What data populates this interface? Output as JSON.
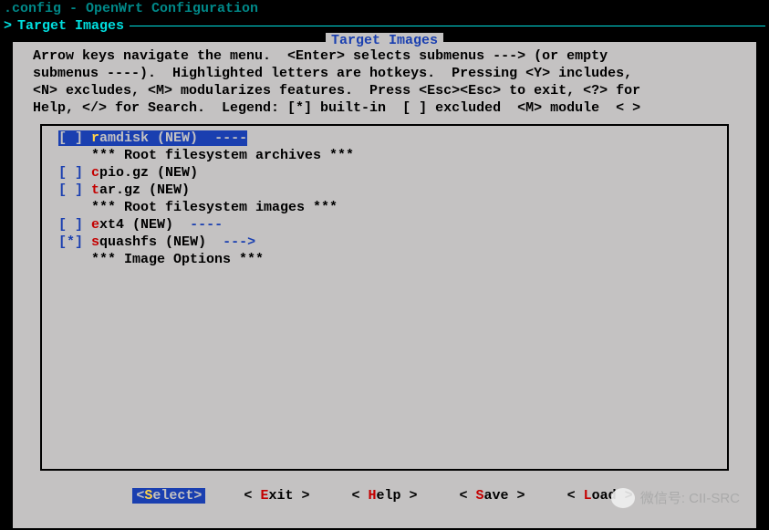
{
  "topLineDim": ".config - OpenWrt Configuration",
  "breadcrumb": {
    "gt": ">",
    "text": "Target Images"
  },
  "dialog": {
    "title": " Target Images ",
    "help": "Arrow keys navigate the menu.  <Enter> selects submenus ---> (or empty\nsubmenus ----).  Highlighted letters are hotkeys.  Pressing <Y> includes,\n<N> excludes, <M> modularizes features.  Press <Esc><Esc> to exit, <?> for\nHelp, </> for Search.  Legend: [*] built-in  [ ] excluded  <M> module  < >"
  },
  "menu": [
    {
      "kind": "item",
      "selected": true,
      "mark": " ",
      "hot": "r",
      "rest": "amdisk (NEW)",
      "arrow": "  ----"
    },
    {
      "kind": "header",
      "text": "    *** Root filesystem archives ***"
    },
    {
      "kind": "item",
      "selected": false,
      "mark": " ",
      "hot": "c",
      "rest": "pio.gz (NEW)",
      "arrow": ""
    },
    {
      "kind": "item",
      "selected": false,
      "mark": " ",
      "hot": "t",
      "rest": "ar.gz (NEW)",
      "arrow": ""
    },
    {
      "kind": "header",
      "text": "    *** Root filesystem images ***"
    },
    {
      "kind": "item",
      "selected": false,
      "mark": " ",
      "hot": "e",
      "rest": "xt4 (NEW)",
      "arrow": "  ----"
    },
    {
      "kind": "item",
      "selected": false,
      "mark": "*",
      "hot": "s",
      "rest": "quashfs (NEW)",
      "arrow": "  --->"
    },
    {
      "kind": "header",
      "text": "    *** Image Options ***"
    }
  ],
  "buttons": [
    {
      "pre": "<",
      "hot": "S",
      "rest": "elect>",
      "active": true
    },
    {
      "pre": "< ",
      "hot": "E",
      "rest": "xit >",
      "active": false
    },
    {
      "pre": "< ",
      "hot": "H",
      "rest": "elp >",
      "active": false
    },
    {
      "pre": "< ",
      "hot": "S",
      "rest": "ave >",
      "active": false
    },
    {
      "pre": "< ",
      "hot": "L",
      "rest": "oad >",
      "active": false
    }
  ],
  "watermark": "微信号: CII-SRC"
}
